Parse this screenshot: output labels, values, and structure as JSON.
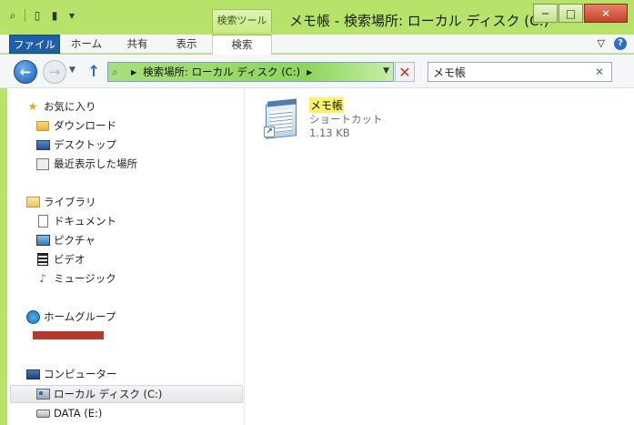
{
  "window": {
    "title": "メモ帳 - 検索場所: ローカル ディスク (C:)",
    "context_tab_header": "検索ツール",
    "buttons": {
      "minimize": "─",
      "maximize": "□",
      "close": "✕"
    }
  },
  "quick_access": {
    "search_glyph": "⌕",
    "dropdown": "▾"
  },
  "ribbon": {
    "tabs": [
      "ファイル",
      "ホーム",
      "共有",
      "表示",
      "検索"
    ],
    "expand_glyph": "▽",
    "help_glyph": "?"
  },
  "address": {
    "back": "←",
    "forward": "→",
    "up": "↑",
    "crumb": "検索場所: ローカル ディスク (C:)",
    "stop_glyph": "✕",
    "search_value": "メモ帳",
    "search_clear": "✕"
  },
  "nav": {
    "favorites": {
      "label": "お気に入り",
      "items": [
        "ダウンロード",
        "デスクトップ",
        "最近表示した場所"
      ]
    },
    "libraries": {
      "label": "ライブラリ",
      "items": [
        "ドキュメント",
        "ピクチャ",
        "ビデオ",
        "ミュージック"
      ]
    },
    "homegroup": {
      "label": "ホームグループ"
    },
    "computer": {
      "label": "コンピューター",
      "items": [
        "ローカル ディスク (C:)",
        "DATA (E:)"
      ]
    }
  },
  "result": {
    "name": "メモ帳",
    "type": "ショートカット",
    "size": "1.13 KB"
  }
}
